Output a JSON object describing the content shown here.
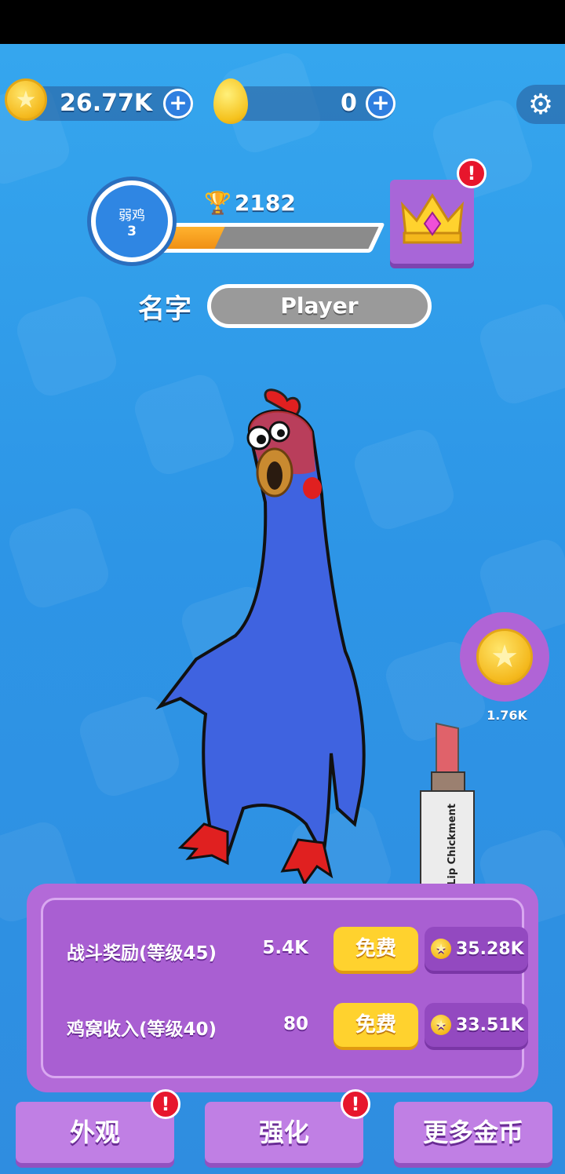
{
  "currency": {
    "coins": "26.77K",
    "eggs": "0"
  },
  "player": {
    "level_title": "弱鸡",
    "level_number": "3",
    "trophies": "2182",
    "xp_progress": 0.3,
    "name_label": "名字",
    "name_value": "Player"
  },
  "side_reward": {
    "value": "1.76K"
  },
  "lipstick": {
    "text": "Lip Chickment"
  },
  "rewards": [
    {
      "label": "战斗奖励(等级45)",
      "amount": "5.4K",
      "free_label": "免费",
      "cost": "35.28K"
    },
    {
      "label": "鸡窝收入(等级40)",
      "amount": "80",
      "free_label": "免费",
      "cost": "33.51K"
    }
  ],
  "nav": {
    "appearance": "外观",
    "upgrade": "强化",
    "more_coins": "更多金币"
  },
  "icons": {
    "coin": "coin-icon",
    "egg": "egg-icon",
    "settings": "gear-icon",
    "trophy": "trophy-icon",
    "crown": "crown-icon",
    "alert": "alert-icon"
  },
  "colors": {
    "background": "#2b93e6",
    "panel": "#b36ad8",
    "free_button": "#ffd22e",
    "alert": "#e7162c"
  }
}
